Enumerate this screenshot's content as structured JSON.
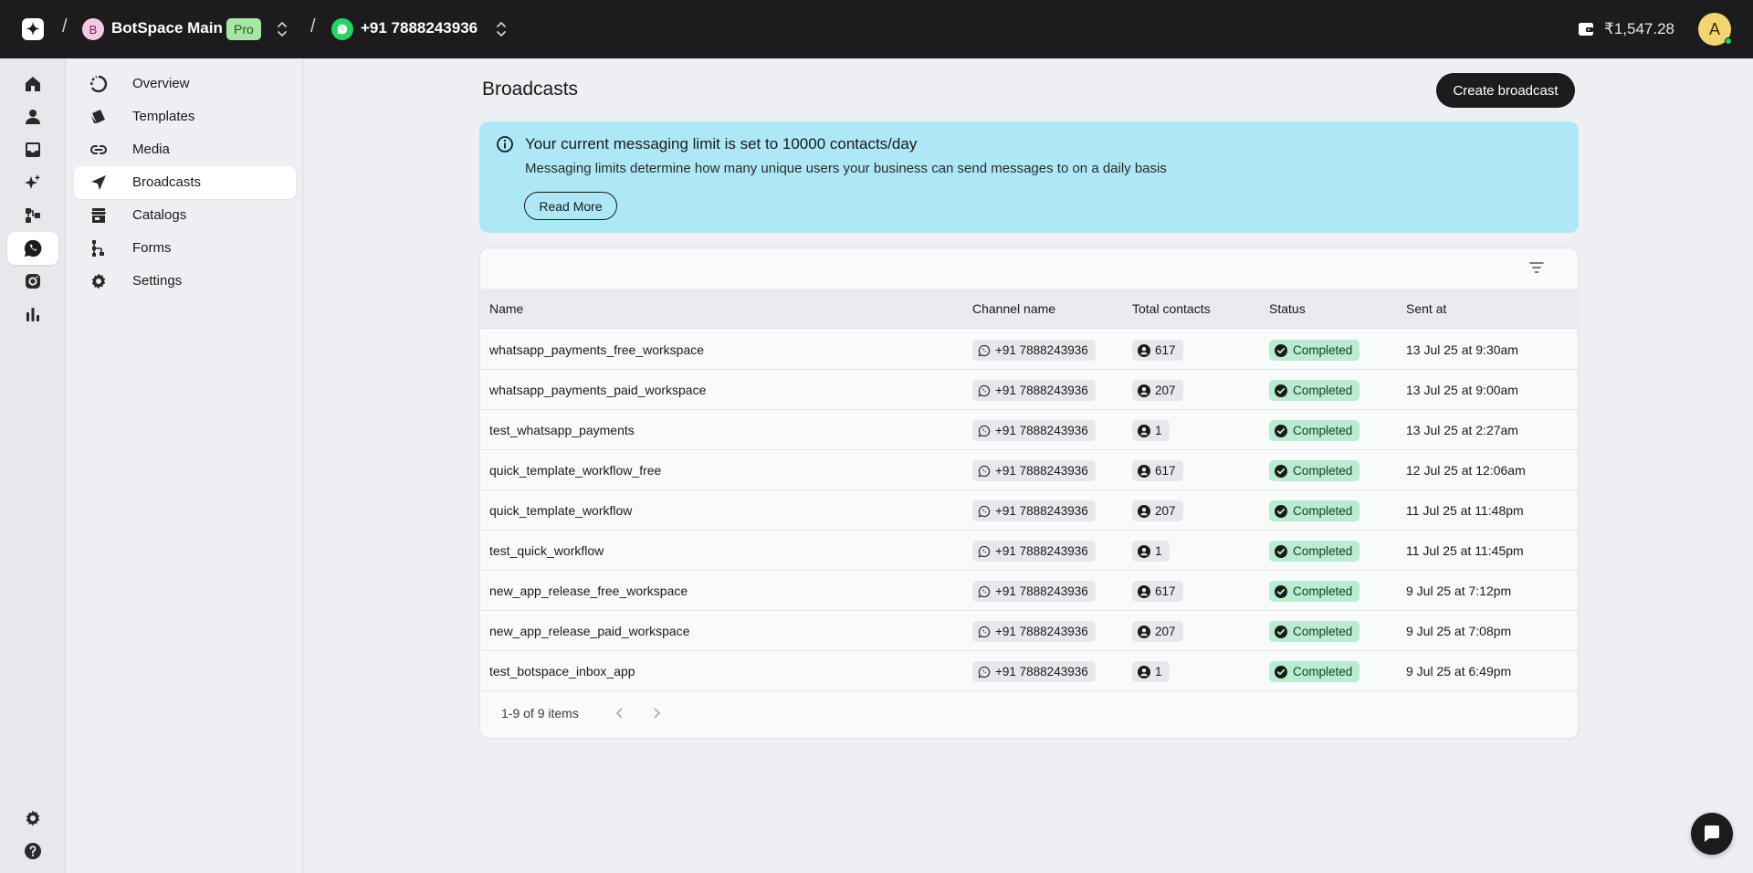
{
  "topbar": {
    "logo_glyph": "✦",
    "separator": "/",
    "workspace": {
      "initial": "B",
      "name": "BotSpace Main",
      "plan_badge": "Pro"
    },
    "channel": {
      "name": "+91 7888243936"
    },
    "balance": "₹1,547.28",
    "user_initial": "A"
  },
  "rail": {
    "items": [
      {
        "icon": "home-icon"
      },
      {
        "icon": "contacts-icon"
      },
      {
        "icon": "inbox-icon"
      },
      {
        "icon": "sparkle-icon"
      },
      {
        "icon": "workflow-icon"
      },
      {
        "icon": "whatsapp-icon",
        "active": true
      },
      {
        "icon": "instagram-icon"
      },
      {
        "icon": "analytics-icon"
      }
    ],
    "bottom": [
      {
        "icon": "settings-icon"
      },
      {
        "icon": "help-icon"
      }
    ]
  },
  "subnav": {
    "items": [
      {
        "label": "Overview",
        "icon": "overview-icon"
      },
      {
        "label": "Templates",
        "icon": "templates-icon"
      },
      {
        "label": "Media",
        "icon": "link-icon"
      },
      {
        "label": "Broadcasts",
        "icon": "send-icon",
        "active": true
      },
      {
        "label": "Catalogs",
        "icon": "store-icon"
      },
      {
        "label": "Forms",
        "icon": "forms-icon"
      },
      {
        "label": "Settings",
        "icon": "gear-icon"
      }
    ]
  },
  "main": {
    "title": "Broadcasts",
    "create_label": "Create broadcast",
    "banner": {
      "title": "Your current messaging limit is set to 10000 contacts/day",
      "description": "Messaging limits determine how many unique users your business can send messages to on a daily basis",
      "button": "Read More"
    },
    "table": {
      "columns": [
        "Name",
        "Channel name",
        "Total contacts",
        "Status",
        "Sent at"
      ],
      "rows": [
        {
          "name": "whatsapp_payments_free_workspace",
          "channel": "+91 7888243936",
          "contacts": "617",
          "status": "Completed",
          "sent_at": "13 Jul 25 at 9:30am"
        },
        {
          "name": "whatsapp_payments_paid_workspace",
          "channel": "+91 7888243936",
          "contacts": "207",
          "status": "Completed",
          "sent_at": "13 Jul 25 at 9:00am"
        },
        {
          "name": "test_whatsapp_payments",
          "channel": "+91 7888243936",
          "contacts": "1",
          "status": "Completed",
          "sent_at": "13 Jul 25 at 2:27am"
        },
        {
          "name": "quick_template_workflow_free",
          "channel": "+91 7888243936",
          "contacts": "617",
          "status": "Completed",
          "sent_at": "12 Jul 25 at 12:06am"
        },
        {
          "name": "quick_template_workflow",
          "channel": "+91 7888243936",
          "contacts": "207",
          "status": "Completed",
          "sent_at": "11 Jul 25 at 11:48pm"
        },
        {
          "name": "test_quick_workflow",
          "channel": "+91 7888243936",
          "contacts": "1",
          "status": "Completed",
          "sent_at": "11 Jul 25 at 11:45pm"
        },
        {
          "name": "new_app_release_free_workspace",
          "channel": "+91 7888243936",
          "contacts": "617",
          "status": "Completed",
          "sent_at": "9 Jul 25 at 7:12pm"
        },
        {
          "name": "new_app_release_paid_workspace",
          "channel": "+91 7888243936",
          "contacts": "207",
          "status": "Completed",
          "sent_at": "9 Jul 25 at 7:08pm"
        },
        {
          "name": "test_botspace_inbox_app",
          "channel": "+91 7888243936",
          "contacts": "1",
          "status": "Completed",
          "sent_at": "9 Jul 25 at 6:49pm"
        }
      ],
      "pagination": "1-9 of 9 items"
    }
  },
  "colors": {
    "topbar": "#1c1c1e",
    "banner": "#aee8f7",
    "status_completed": "#b9ecd0",
    "whatsapp": "#25d366",
    "pro_badge": "#a8e6a6"
  }
}
